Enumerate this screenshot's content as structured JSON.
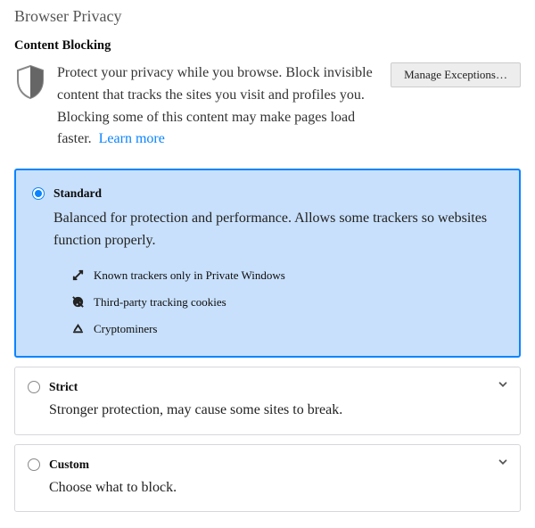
{
  "pageTitle": "Browser Privacy",
  "section": {
    "title": "Content Blocking",
    "intro": "Protect your privacy while you browse. Block invisible content that tracks the sites you visit and profiles you. Blocking some of this content may make pages load faster.",
    "learnMore": "Learn more",
    "manageExceptions": "Manage Exceptions…"
  },
  "options": {
    "standard": {
      "label": "Standard",
      "desc": "Balanced for protection and performance. Allows some trackers so websites function properly.",
      "features": {
        "trackers": "Known trackers only in Private Windows",
        "cookies": "Third-party tracking cookies",
        "crypto": "Cryptominers"
      },
      "selected": true
    },
    "strict": {
      "label": "Strict",
      "desc": "Stronger protection, may cause some sites to break.",
      "selected": false
    },
    "custom": {
      "label": "Custom",
      "desc": "Choose what to block.",
      "selected": false
    }
  }
}
